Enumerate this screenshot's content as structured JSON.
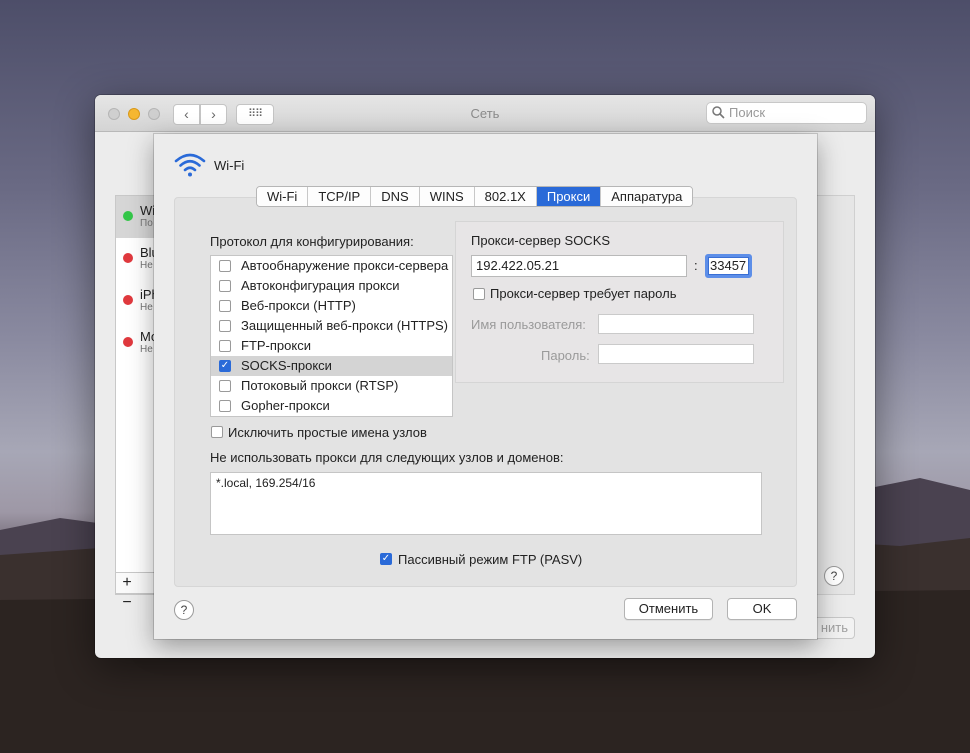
{
  "window": {
    "title": "Сеть",
    "search_placeholder": "Поиск"
  },
  "background_list": {
    "items": [
      {
        "name": "Wi",
        "status": "По",
        "color": "#34c749"
      },
      {
        "name": "Blu",
        "status": "Не",
        "color": "#e0393e"
      },
      {
        "name": "iPh",
        "status": "Не",
        "color": "#e0393e"
      },
      {
        "name": "Mo",
        "status": "Не",
        "color": "#e0393e"
      }
    ],
    "add": "+",
    "remove": "−",
    "help": "?",
    "apply_label": "нить"
  },
  "sheet": {
    "interface_name": "Wi-Fi",
    "tabs": [
      {
        "label": "Wi-Fi",
        "active": false
      },
      {
        "label": "TCP/IP",
        "active": false
      },
      {
        "label": "DNS",
        "active": false
      },
      {
        "label": "WINS",
        "active": false
      },
      {
        "label": "802.1X",
        "active": false
      },
      {
        "label": "Прокси",
        "active": true
      },
      {
        "label": "Аппаратура",
        "active": false
      }
    ],
    "protocol_label": "Протокол для конфигурирования:",
    "protocols": [
      {
        "label": "Автообнаружение прокси-сервера",
        "checked": false,
        "selected": false
      },
      {
        "label": "Автоконфигурация прокси",
        "checked": false,
        "selected": false
      },
      {
        "label": "Веб-прокси (HTTP)",
        "checked": false,
        "selected": false
      },
      {
        "label": "Защищенный веб-прокси (HTTPS)",
        "checked": false,
        "selected": false
      },
      {
        "label": "FTP-прокси",
        "checked": false,
        "selected": false
      },
      {
        "label": "SOCKS-прокси",
        "checked": true,
        "selected": true
      },
      {
        "label": "Потоковый прокси (RTSP)",
        "checked": false,
        "selected": false
      },
      {
        "label": "Gopher-прокси",
        "checked": false,
        "selected": false
      }
    ],
    "socks": {
      "title": "Прокси-сервер SOCKS",
      "server": "192.422.05.21",
      "colon": ":",
      "port": "33457",
      "requires_password_label": "Прокси-сервер требует пароль",
      "username_label": "Имя пользователя:",
      "password_label": "Пароль:"
    },
    "exclude_simple_label": "Исключить простые имена узлов",
    "bypass_label": "Не использовать прокси для следующих узлов и доменов:",
    "bypass_value": "*.local, 169.254/16",
    "pasv_label": "Пассивный режим FTP (PASV)",
    "help": "?",
    "cancel_label": "Отменить",
    "ok_label": "OK"
  },
  "colors": {
    "accent": "#2a6ad8"
  }
}
